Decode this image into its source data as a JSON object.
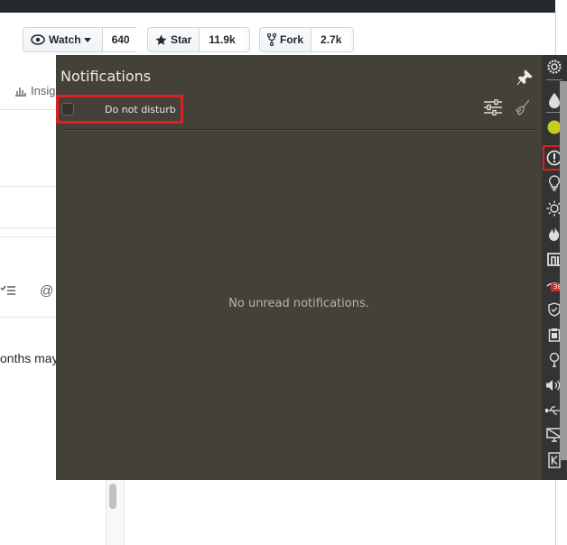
{
  "github": {
    "watch": {
      "label": "Watch",
      "count": "640"
    },
    "star": {
      "label": "Star",
      "count": "11.9k"
    },
    "fork": {
      "label": "Fork",
      "count": "2.7k"
    },
    "tab_partial": "Insig",
    "text_partial": "onths may"
  },
  "notifications": {
    "title": "Notifications",
    "do_not_disturb_label": "Do not disturb",
    "do_not_disturb_checked": false,
    "empty_message": "No unread notifications."
  },
  "tray": {
    "icons": [
      "settings-icon",
      "drop-icon",
      "status-dot-icon",
      "notification-alert-icon",
      "bulb-icon",
      "brightness-icon",
      "flame-icon",
      "building-icon",
      "network-icon",
      "shield-icon",
      "clipboard-icon",
      "bulb-outline-icon",
      "volume-icon",
      "usb-icon",
      "display-icon",
      "k-icon"
    ],
    "network_badge": "38"
  },
  "colors": {
    "panel_bg": "#444139",
    "highlight": "#e02020",
    "status_dot": "#c8cc1e"
  }
}
